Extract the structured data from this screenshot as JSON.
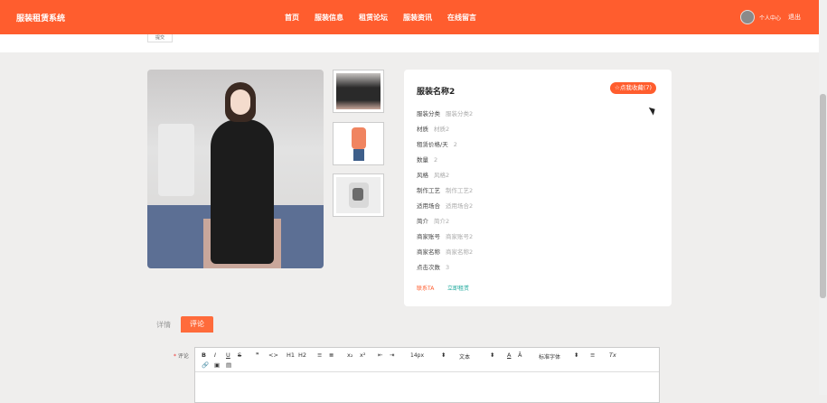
{
  "header": {
    "brand": "服装租赁系统",
    "nav": [
      "首页",
      "服装信息",
      "租赁论坛",
      "服装资讯",
      "在线留言"
    ],
    "user_center": "个人中心",
    "logout": "退出"
  },
  "search_button": "提交",
  "product": {
    "title": "服装名称2",
    "collect_label": "☆点我收藏(7)",
    "fields": [
      {
        "k": "服装分类",
        "v": "服装分类2"
      },
      {
        "k": "材质",
        "v": "材质2"
      },
      {
        "k": "租赁价格/天",
        "v": "2"
      },
      {
        "k": "数量",
        "v": "2"
      },
      {
        "k": "风格",
        "v": "风格2"
      },
      {
        "k": "制作工艺",
        "v": "制作工艺2"
      },
      {
        "k": "适用场合",
        "v": "适用场合2"
      },
      {
        "k": "简介",
        "v": "简介2"
      },
      {
        "k": "商家账号",
        "v": "商家账号2"
      },
      {
        "k": "商家名称",
        "v": "商家名称2"
      },
      {
        "k": "点击次数",
        "v": "3"
      }
    ],
    "contact": "联系TA",
    "rent_now": "立即租赁"
  },
  "tabs": {
    "detail": "详情",
    "comment": "评论"
  },
  "comment": {
    "label_req": "*",
    "label": "评论",
    "toolbar": {
      "bold": "B",
      "italic": "I",
      "underline": "U",
      "strike": "S",
      "quote": "❞",
      "code": "<>",
      "h1": "H1",
      "h2": "H2",
      "ol": "≡",
      "ul": "≣",
      "sub": "x₂",
      "sup": "x²",
      "indent_dec": "⇤",
      "indent_inc": "⇥",
      "size": "14px",
      "paragraph": "文本",
      "font_color": "A",
      "bg_color": "Ā",
      "font": "标准字体",
      "align": "≡",
      "clear": "Tx",
      "link": "🔗",
      "image": "▣",
      "video": "▤"
    }
  }
}
